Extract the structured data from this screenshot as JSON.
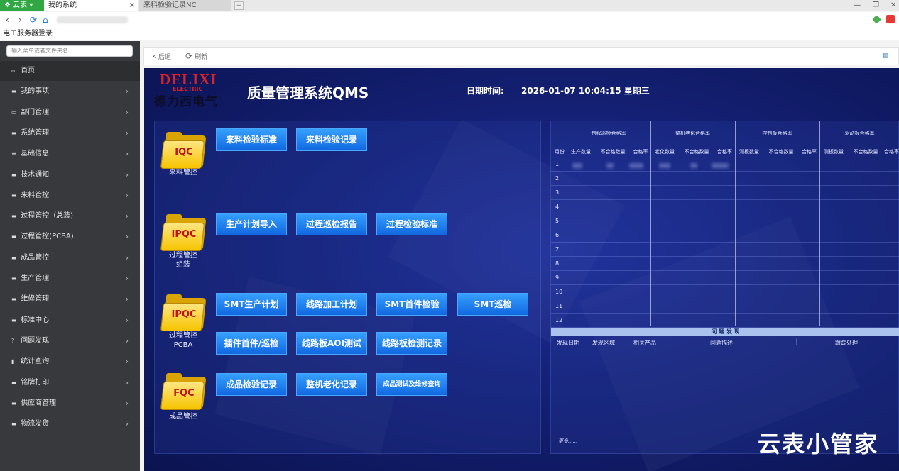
{
  "browser": {
    "app_badge": "云表",
    "tabs": [
      {
        "label": "我的系统",
        "close": "×"
      },
      {
        "label": "来料检验记录NC"
      }
    ],
    "nav": {
      "back": "‹",
      "forward": "›",
      "refresh": "⟳",
      "home": "⌂"
    },
    "bookmark": "电工服务器登录",
    "window_controls": [
      "—",
      "❐",
      "✕"
    ]
  },
  "sidebar": {
    "search_placeholder": "输入菜单或者文件夹名",
    "items": [
      {
        "label": "首页"
      },
      {
        "label": "我的事项"
      },
      {
        "label": "部门管理"
      },
      {
        "label": "系统管理"
      },
      {
        "label": "基础信息"
      },
      {
        "label": "技术通知"
      },
      {
        "label": "来料管控"
      },
      {
        "label": "过程管控（总装)"
      },
      {
        "label": "过程管控(PCBA)"
      },
      {
        "label": "成品管控"
      },
      {
        "label": "生产管理"
      },
      {
        "label": "维修管理"
      },
      {
        "label": "标准中心"
      },
      {
        "label": "问题发现"
      },
      {
        "label": "统计查询"
      },
      {
        "label": "铭牌打印"
      },
      {
        "label": "供应商管理"
      },
      {
        "label": "物流发货"
      }
    ]
  },
  "toolbar": {
    "back_label": "后退",
    "refresh_label": "刷新"
  },
  "dashboard": {
    "logo": {
      "brand": "DELIXI",
      "sub": "ELECTRIC",
      "cn": "德力西电气"
    },
    "title": "质量管理系统QMS",
    "datetime_label": "日期时间:",
    "datetime_value": "2026-01-07 10:04:15 星期三",
    "categories": [
      {
        "icon_text": "IQC",
        "label": "来料管控",
        "buttons": [
          "来料检验标准",
          "来料检验记录"
        ]
      },
      {
        "icon_text": "IPQC",
        "label": "过程管控\n组装",
        "buttons": [
          "生产计划导入",
          "过程巡检报告",
          "过程检验标准"
        ]
      },
      {
        "icon_text": "IPQC",
        "label": "过程管控\nPCBA",
        "buttons": [
          "SMT生产计划",
          "线路加工计划",
          "SMT首件检验",
          "SMT巡检",
          "插件首件/巡检",
          "线路板AOI测试",
          "线路板检测记录"
        ]
      },
      {
        "icon_text": "FQC",
        "label": "成品管控",
        "buttons": [
          "成品检验记录",
          "整机老化记录",
          "成品测试及维修查询"
        ]
      }
    ],
    "table": {
      "groups": [
        "制程巡检合格率",
        "整机老化合格率",
        "控制板合格率",
        "驱动板合格率"
      ],
      "month_label": "月份",
      "subheaders": [
        "生产数量",
        "不合格数量",
        "合格率",
        "老化数量",
        "不合格数量",
        "合格率",
        "测板数量",
        "不合格数量",
        "合格率",
        "测板数量",
        "不合格数量",
        "合格率"
      ],
      "rows": [
        "1",
        "2",
        "3",
        "4",
        "5",
        "6",
        "7",
        "8",
        "9",
        "10",
        "11",
        "12"
      ]
    },
    "problems": {
      "title": "问 题 发 现",
      "columns": [
        "发现日期",
        "发现区域",
        "相关产品",
        "问题描述",
        "跟踪处理"
      ],
      "more": "更多......"
    }
  },
  "watermark": "云表小管家"
}
